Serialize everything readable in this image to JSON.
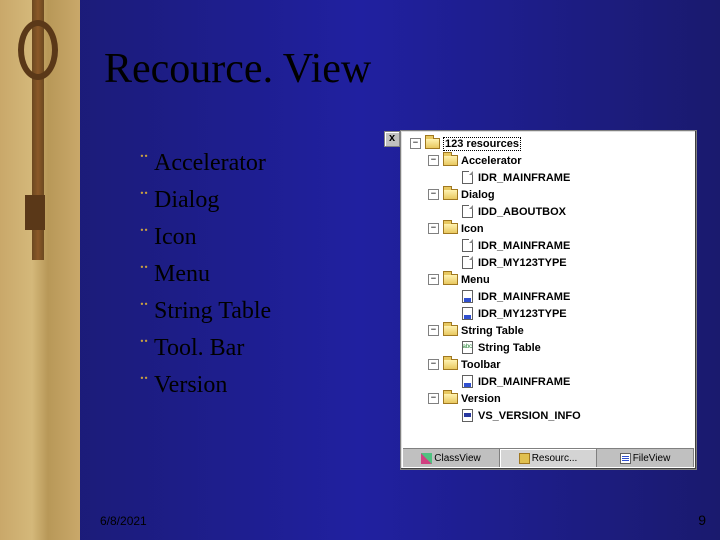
{
  "slide": {
    "title": "Recource. View",
    "bullets": [
      "Accelerator",
      "Dialog",
      "Icon",
      "Menu",
      "String Table",
      "Tool. Bar",
      "Version"
    ],
    "date": "6/8/2021",
    "page": "9"
  },
  "panel": {
    "close": "x",
    "root": "123 resources",
    "nodes": {
      "accel": "Accelerator",
      "accel_item": "IDR_MAINFRAME",
      "dialog": "Dialog",
      "dialog_item": "IDD_ABOUTBOX",
      "icon": "Icon",
      "icon_item1": "IDR_MAINFRAME",
      "icon_item2": "IDR_MY123TYPE",
      "menu": "Menu",
      "menu_item1": "IDR_MAINFRAME",
      "menu_item2": "IDR_MY123TYPE",
      "strtbl": "String Table",
      "strtbl_item": "String Table",
      "toolbar": "Toolbar",
      "toolbar_item": "IDR_MAINFRAME",
      "version": "Version",
      "version_item": "VS_VERSION_INFO"
    },
    "tabs": {
      "classview": "ClassView",
      "resourceview": "Resourc...",
      "fileview": "FileView"
    }
  }
}
